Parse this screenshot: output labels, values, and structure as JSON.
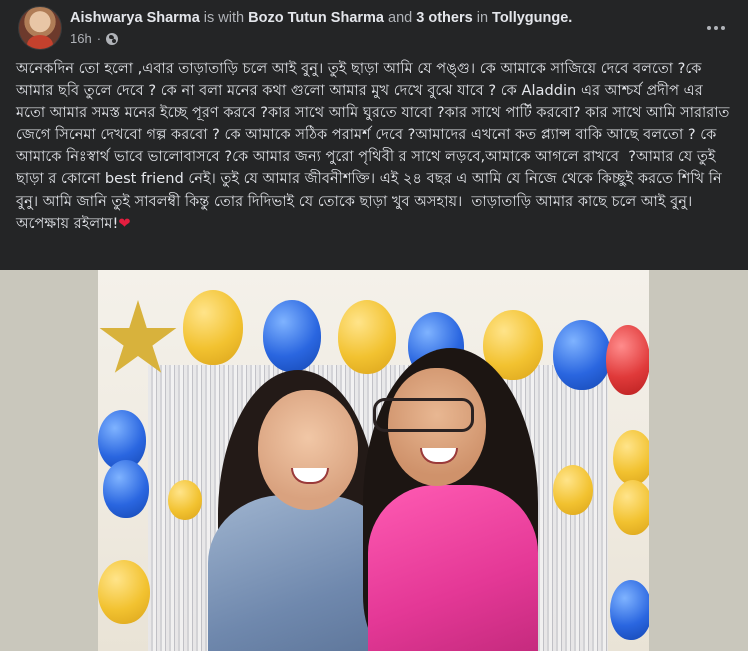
{
  "post": {
    "author": "Aishwarya Sharma",
    "connector_with": "is with",
    "tagged_person": "Bozo Tutun Sharma",
    "connector_and": "and",
    "others": "3 others",
    "connector_in": "in",
    "location": "Tollygunge.",
    "timestamp": "16h",
    "separator": "·",
    "privacy_icon": "globe-icon",
    "more_icon": "more-horizontal-icon",
    "text": "অনেকদিন তো হলো ,এবার তাড়াতাড়ি চলে আই বুনু। তুই ছাড়া আমি যে পঙ্গু। কে আমাকে সাজিয়ে দেবে বলতো ?কে আমার ছবি তুলে দেবে ? কে না বলা মনের কথা গুলো আমার মুখ দেখে বুঝে যাবে ? কে Aladdin এর আশ্চর্য প্রদীপ এর মতো আমার সমস্ত মনের ইচ্ছে পূরণ করবে ?কার সাথে আমি ঘুরতে যাবো ?কার সাথে পার্টি করবো? কার সাথে আমি সারারাত জেগে সিনেমা দেখবো গল্প করবো ? কে আমাকে সঠিক পরামর্শ দেবে ?আমাদের এখনো কত প্ল্যান্স বাকি আছে বলতো ? কে আমাকে নিঃস্বার্থ ভাবে ভালোবাসবে ?কে আমার জন্য পুরো পৃথিবী র সাথে লড়বে,আমাকে আগলে রাখবে  ?আমার যে তুই ছাড়া র কোনো best friend নেই। তুই যে আমার জীবনীশক্তি। এই ২৪ বছর এ আমি যে নিজে থেকে কিচ্ছুই করতে শিখি নি বুনু। আমি জানি তুই সাবলম্বী কিন্তু তোর দিদিভাই যে তোকে ছাড়া খুব অসহায়।  তাড়াতাড়ি আমার কাছে চলে আই বুনু।  অপেক্ষায় রইলাম!",
    "heart_emoji": "❤"
  },
  "colors": {
    "background": "#242526",
    "text_primary": "#e4e6eb",
    "text_secondary": "#b0b3b8",
    "heart": "#e41e3f"
  }
}
